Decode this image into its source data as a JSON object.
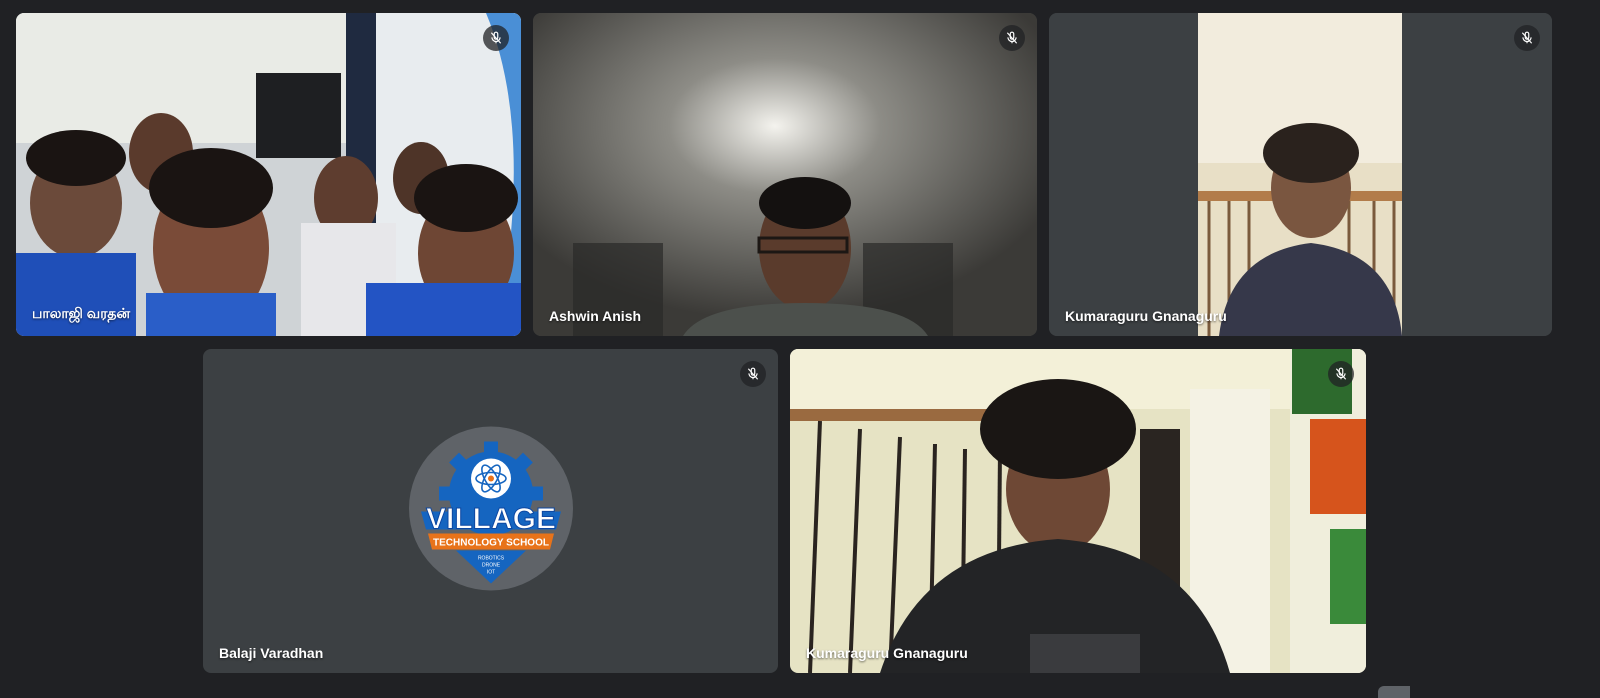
{
  "participants": [
    {
      "name": "பாலாஜி வரதன்",
      "muted": true
    },
    {
      "name": "Ashwin Anish",
      "muted": true
    },
    {
      "name": "Kumaraguru Gnanaguru",
      "muted": true
    },
    {
      "name": "Balaji Varadhan",
      "muted": true
    },
    {
      "name": "Kumaraguru Gnanaguru",
      "muted": true
    }
  ],
  "logo": {
    "title": "VILLAGE",
    "banner": "TECHNOLOGY SCHOOL",
    "lines": [
      "ROBOTICS",
      "DRONE",
      "IOT"
    ]
  },
  "colors": {
    "background": "#202124",
    "tile": "#3c4043",
    "logo_blue": "#1565c0",
    "logo_orange": "#e8731a"
  }
}
